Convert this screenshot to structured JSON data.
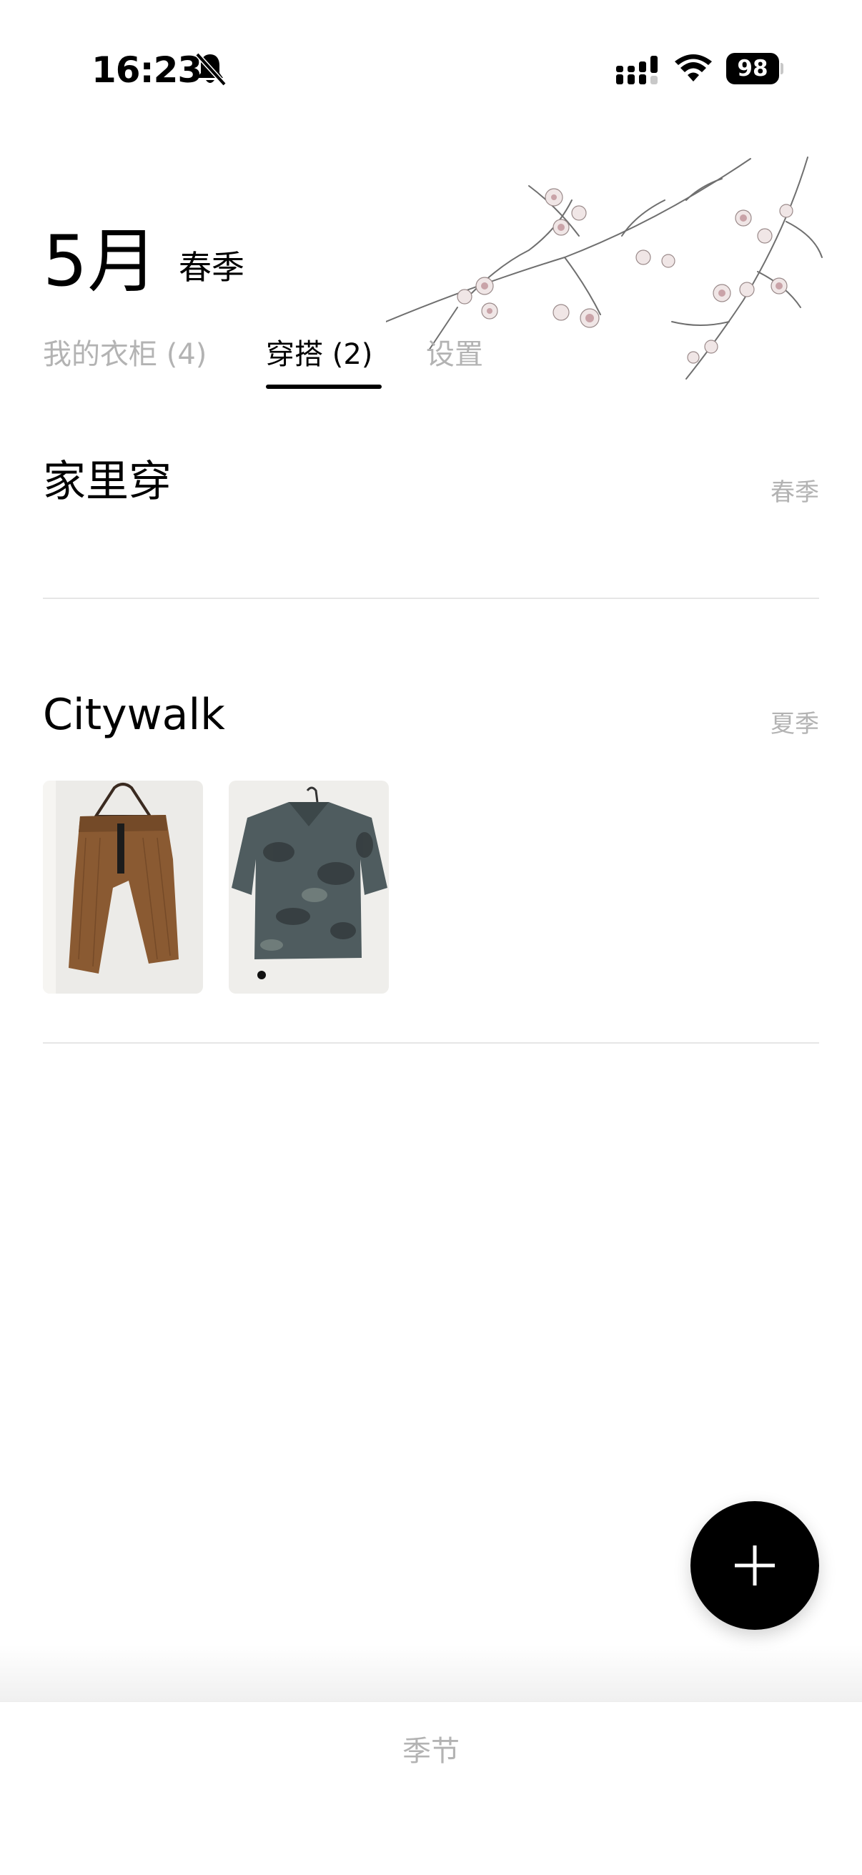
{
  "status_bar": {
    "time": "16:23",
    "battery": "98",
    "icons": [
      "bell-slash-icon",
      "signal-icon",
      "wifi-icon",
      "battery-icon"
    ]
  },
  "header": {
    "month": "5月",
    "season": "春季",
    "decoration": "cherry-blossom-branch"
  },
  "tabs": [
    {
      "label": "我的衣柜 (4)",
      "active": false
    },
    {
      "label": "穿搭 (2)",
      "active": true
    },
    {
      "label": "设置",
      "active": false
    }
  ],
  "outfits": [
    {
      "title": "家里穿",
      "season": "春季",
      "items": []
    },
    {
      "title": "Citywalk",
      "season": "夏季",
      "items": [
        "brown-corduroy-pants",
        "camo-short-sleeve-shirt"
      ]
    }
  ],
  "fab": {
    "icon": "plus-icon"
  },
  "bottom_nav": {
    "label": "季节"
  }
}
